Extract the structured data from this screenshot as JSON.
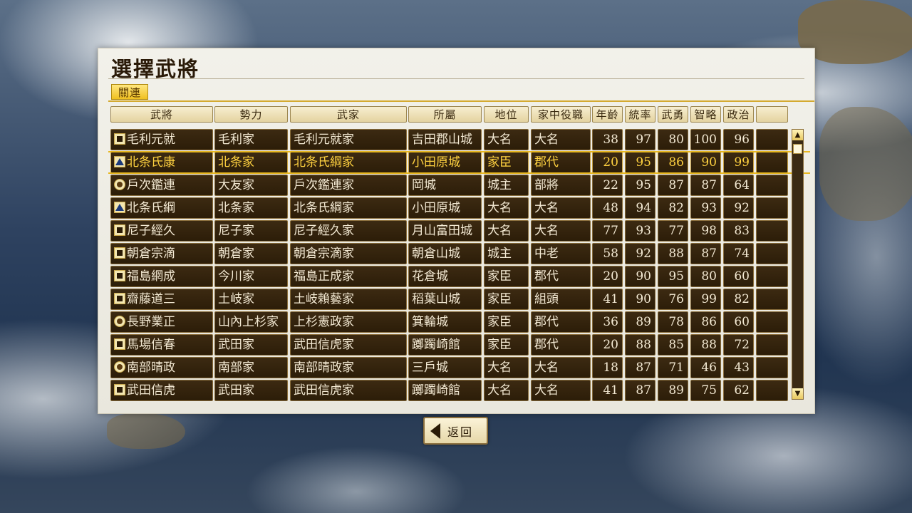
{
  "dialog": {
    "title": "選擇武將",
    "tab_label": "關連",
    "headers": [
      "武將",
      "勢力",
      "武家",
      "所屬",
      "地位",
      "家中役職",
      "年齡",
      "統率",
      "武勇",
      "智略",
      "政治",
      ""
    ],
    "selected_index": 1,
    "rows": [
      {
        "crest": "square",
        "name": "毛利元就",
        "faction": "毛利家",
        "clan": "毛利元就家",
        "castle": "吉田郡山城",
        "rank": "大名",
        "role": "大名",
        "age": "38",
        "lead": "97",
        "valor": "80",
        "intel": "100",
        "politics": "96"
      },
      {
        "crest": "tri",
        "name": "北条氏康",
        "faction": "北条家",
        "clan": "北条氏綱家",
        "castle": "小田原城",
        "rank": "家臣",
        "role": "郡代",
        "age": "20",
        "lead": "95",
        "valor": "86",
        "intel": "90",
        "politics": "99"
      },
      {
        "crest": "round",
        "name": "戶次鑑連",
        "faction": "大友家",
        "clan": "戶次鑑連家",
        "castle": "岡城",
        "rank": "城主",
        "role": "部將",
        "age": "22",
        "lead": "95",
        "valor": "87",
        "intel": "87",
        "politics": "64"
      },
      {
        "crest": "tri",
        "name": "北条氏綱",
        "faction": "北条家",
        "clan": "北条氏綱家",
        "castle": "小田原城",
        "rank": "大名",
        "role": "大名",
        "age": "48",
        "lead": "94",
        "valor": "82",
        "intel": "93",
        "politics": "92"
      },
      {
        "crest": "square",
        "name": "尼子經久",
        "faction": "尼子家",
        "clan": "尼子經久家",
        "castle": "月山富田城",
        "rank": "大名",
        "role": "大名",
        "age": "77",
        "lead": "93",
        "valor": "77",
        "intel": "98",
        "politics": "83"
      },
      {
        "crest": "square",
        "name": "朝倉宗滴",
        "faction": "朝倉家",
        "clan": "朝倉宗滴家",
        "castle": "朝倉山城",
        "rank": "城主",
        "role": "中老",
        "age": "58",
        "lead": "92",
        "valor": "88",
        "intel": "87",
        "politics": "74"
      },
      {
        "crest": "square",
        "name": "福島網成",
        "faction": "今川家",
        "clan": "福島正成家",
        "castle": "花倉城",
        "rank": "家臣",
        "role": "郡代",
        "age": "20",
        "lead": "90",
        "valor": "95",
        "intel": "80",
        "politics": "60"
      },
      {
        "crest": "square",
        "name": "齋藤道三",
        "faction": "土岐家",
        "clan": "土岐賴藝家",
        "castle": "稻葉山城",
        "rank": "家臣",
        "role": "組頭",
        "age": "41",
        "lead": "90",
        "valor": "76",
        "intel": "99",
        "politics": "82"
      },
      {
        "crest": "round",
        "name": "長野業正",
        "faction": "山內上杉家",
        "clan": "上杉憲政家",
        "castle": "箕輪城",
        "rank": "家臣",
        "role": "郡代",
        "age": "36",
        "lead": "89",
        "valor": "78",
        "intel": "86",
        "politics": "60"
      },
      {
        "crest": "square",
        "name": "馬場信春",
        "faction": "武田家",
        "clan": "武田信虎家",
        "castle": "躑躅崎館",
        "rank": "家臣",
        "role": "郡代",
        "age": "20",
        "lead": "88",
        "valor": "85",
        "intel": "88",
        "politics": "72"
      },
      {
        "crest": "round",
        "name": "南部晴政",
        "faction": "南部家",
        "clan": "南部晴政家",
        "castle": "三戶城",
        "rank": "大名",
        "role": "大名",
        "age": "18",
        "lead": "87",
        "valor": "71",
        "intel": "46",
        "politics": "43"
      },
      {
        "crest": "square",
        "name": "武田信虎",
        "faction": "武田家",
        "clan": "武田信虎家",
        "castle": "躑躅崎館",
        "rank": "大名",
        "role": "大名",
        "age": "41",
        "lead": "87",
        "valor": "89",
        "intel": "75",
        "politics": "62"
      }
    ],
    "scroll": {
      "up_icon": "▲",
      "down_icon": "▼"
    }
  },
  "back_button": {
    "label": "返回",
    "icon": "chevron-left-icon"
  }
}
